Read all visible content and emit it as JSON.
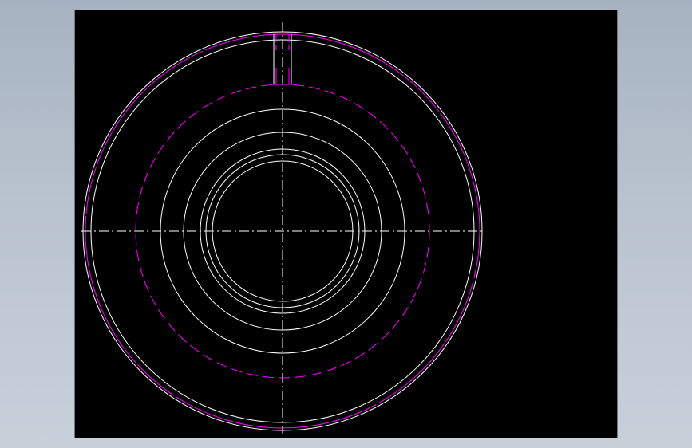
{
  "app": {
    "view": "cad-drawing-viewport"
  },
  "colors": {
    "background": "#b9c3cf",
    "canvas": "#000000",
    "line_primary": "#ffffff",
    "line_secondary": "#ff00ff"
  },
  "drawing": {
    "type": "concentric-ring-section",
    "circles": [
      {
        "name": "outer-rim",
        "style": "solid",
        "color": "white"
      },
      {
        "name": "outer-rim-inner",
        "style": "solid",
        "color": "white"
      },
      {
        "name": "outer-chamfer",
        "style": "solid",
        "color": "magenta"
      },
      {
        "name": "pitch-hidden",
        "style": "dashed",
        "color": "magenta"
      },
      {
        "name": "ring-1",
        "style": "solid",
        "color": "white"
      },
      {
        "name": "ring-2",
        "style": "solid",
        "color": "white"
      },
      {
        "name": "ring-3",
        "style": "solid",
        "color": "white"
      },
      {
        "name": "bore-outer",
        "style": "solid",
        "color": "white"
      },
      {
        "name": "bore-inner",
        "style": "solid",
        "color": "white"
      }
    ]
  }
}
